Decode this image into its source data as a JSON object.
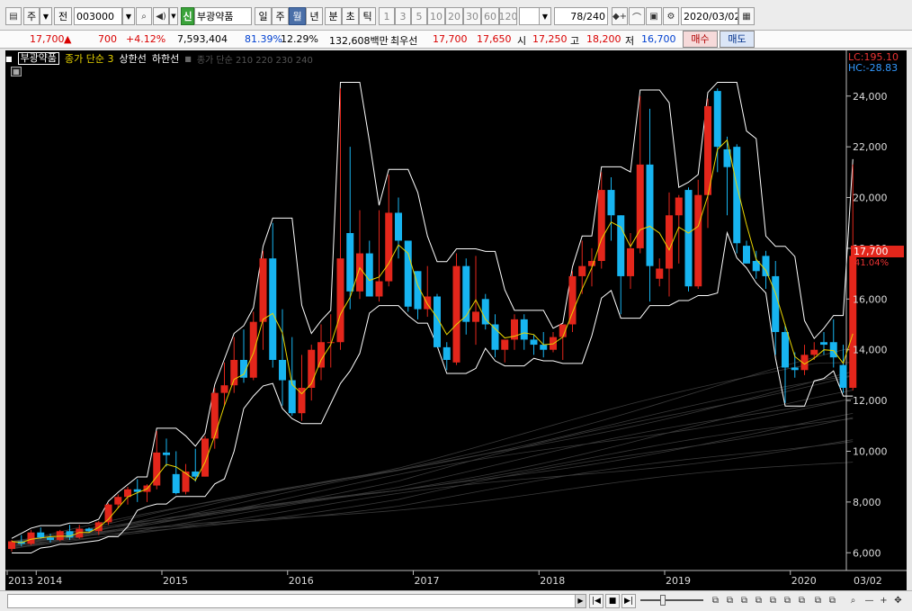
{
  "toolbar": {
    "period_type": "주",
    "prev_label": "전",
    "code": "003000",
    "search_icon": "magnifier-icon",
    "stock_badge": "신",
    "stock_name": "부광약품",
    "period_buttons": [
      "일",
      "주",
      "월",
      "년",
      "분",
      "초",
      "틱"
    ],
    "active_period": "월",
    "interval_buttons": [
      "1",
      "3",
      "5",
      "10",
      "20",
      "30",
      "60",
      "120"
    ],
    "count_value": "78",
    "count_total": "/240",
    "date": "2020/03/02"
  },
  "quote": {
    "price": "17,700",
    "arrow": "▲",
    "change": "700",
    "change_pct": "+4.12%",
    "volume": "7,593,404",
    "vol_ratio": "81.39%",
    "turnover": "12.29%",
    "amount": "132,608백만",
    "best_label": "최우선",
    "ask": "17,700",
    "bid": "17,650",
    "open_label": "시",
    "open": "17,250",
    "high_label": "고",
    "high": "18,200",
    "low_label": "저",
    "low": "16,700",
    "buy_label": "매수",
    "sell_label": "매도"
  },
  "chart_header": {
    "name_box": "부광약품",
    "ma_label": "종가 단순 3",
    "upper_band": "상한선",
    "lower_band": "하한선",
    "long_ma": "종가 단순 210 220 230 240",
    "lc": "LC:195.10",
    "hc": "HC:-28.83",
    "last_price": "17,700",
    "last_pct": "41.04%"
  },
  "colors": {
    "up": "#e3261b",
    "down": "#17b4f0",
    "ma": "#e8d400",
    "band": "#ffffff",
    "bg": "#000000"
  },
  "chart_data": {
    "type": "candlestick",
    "ylim": [
      5300,
      25800
    ],
    "y_ticks": [
      "6,000",
      "8,000",
      "10,000",
      "12,000",
      "14,000",
      "16,000",
      "18,000",
      "20,000",
      "22,000",
      "24,000"
    ],
    "y_tick_values": [
      6000,
      8000,
      10000,
      12000,
      14000,
      16000,
      18000,
      20000,
      22000,
      24000
    ],
    "x_labels": [
      "2013",
      "2014",
      "2015",
      "2016",
      "2017",
      "2018",
      "2019",
      "2020",
      "03/02"
    ],
    "candles": [
      {
        "o": 6150,
        "h": 6500,
        "l": 6050,
        "c": 6450
      },
      {
        "o": 6450,
        "h": 6700,
        "l": 6250,
        "c": 6350
      },
      {
        "o": 6350,
        "h": 6900,
        "l": 6300,
        "c": 6800
      },
      {
        "o": 6800,
        "h": 7000,
        "l": 6550,
        "c": 6600
      },
      {
        "o": 6600,
        "h": 6750,
        "l": 6400,
        "c": 6500
      },
      {
        "o": 6500,
        "h": 6900,
        "l": 6450,
        "c": 6850
      },
      {
        "o": 6850,
        "h": 7100,
        "l": 6500,
        "c": 6600
      },
      {
        "o": 6600,
        "h": 7100,
        "l": 6550,
        "c": 6950
      },
      {
        "o": 6950,
        "h": 7000,
        "l": 6800,
        "c": 6850
      },
      {
        "o": 6850,
        "h": 7250,
        "l": 6700,
        "c": 7200
      },
      {
        "o": 7200,
        "h": 7950,
        "l": 7100,
        "c": 7900
      },
      {
        "o": 7900,
        "h": 8300,
        "l": 7750,
        "c": 8200
      },
      {
        "o": 8200,
        "h": 8600,
        "l": 7900,
        "c": 8500
      },
      {
        "o": 8500,
        "h": 8900,
        "l": 8000,
        "c": 8400
      },
      {
        "o": 8400,
        "h": 8700,
        "l": 8000,
        "c": 8650
      },
      {
        "o": 8650,
        "h": 10800,
        "l": 8500,
        "c": 9950
      },
      {
        "o": 9950,
        "h": 10500,
        "l": 9400,
        "c": 9850
      },
      {
        "o": 9100,
        "h": 10000,
        "l": 8300,
        "c": 8350
      },
      {
        "o": 8400,
        "h": 9500,
        "l": 8300,
        "c": 9200
      },
      {
        "o": 9200,
        "h": 10100,
        "l": 8800,
        "c": 9000
      },
      {
        "o": 9000,
        "h": 10600,
        "l": 9000,
        "c": 10500
      },
      {
        "o": 10500,
        "h": 12500,
        "l": 10100,
        "c": 12300
      },
      {
        "o": 12300,
        "h": 13500,
        "l": 11800,
        "c": 12600
      },
      {
        "o": 12600,
        "h": 14500,
        "l": 12300,
        "c": 13600
      },
      {
        "o": 13600,
        "h": 14800,
        "l": 12700,
        "c": 12900
      },
      {
        "o": 12900,
        "h": 15500,
        "l": 12800,
        "c": 15100
      },
      {
        "o": 15100,
        "h": 17900,
        "l": 14000,
        "c": 17600
      },
      {
        "o": 17600,
        "h": 19000,
        "l": 13300,
        "c": 13600
      },
      {
        "o": 13600,
        "h": 15600,
        "l": 11800,
        "c": 12800
      },
      {
        "o": 12800,
        "h": 14500,
        "l": 11400,
        "c": 11500
      },
      {
        "o": 11500,
        "h": 13800,
        "l": 11200,
        "c": 12500
      },
      {
        "o": 12500,
        "h": 14200,
        "l": 12000,
        "c": 14000
      },
      {
        "o": 13300,
        "h": 15000,
        "l": 12800,
        "c": 14300
      },
      {
        "o": 14300,
        "h": 15400,
        "l": 13300,
        "c": 14300
      },
      {
        "o": 14300,
        "h": 24300,
        "l": 14000,
        "c": 17600
      },
      {
        "o": 18600,
        "h": 22000,
        "l": 15600,
        "c": 16300
      },
      {
        "o": 16300,
        "h": 19500,
        "l": 16000,
        "c": 17800
      },
      {
        "o": 17800,
        "h": 18300,
        "l": 16800,
        "c": 16100
      },
      {
        "o": 16100,
        "h": 19500,
        "l": 15900,
        "c": 16700
      },
      {
        "o": 16700,
        "h": 20900,
        "l": 16500,
        "c": 19400
      },
      {
        "o": 19400,
        "h": 20000,
        "l": 17600,
        "c": 18300
      },
      {
        "o": 18300,
        "h": 18300,
        "l": 15500,
        "c": 15700
      },
      {
        "o": 17100,
        "h": 17100,
        "l": 15200,
        "c": 15600
      },
      {
        "o": 15600,
        "h": 17300,
        "l": 15300,
        "c": 16100
      },
      {
        "o": 16100,
        "h": 16200,
        "l": 14300,
        "c": 14100
      },
      {
        "o": 14100,
        "h": 14300,
        "l": 13200,
        "c": 13600
      },
      {
        "o": 13500,
        "h": 17800,
        "l": 13400,
        "c": 17300
      },
      {
        "o": 17300,
        "h": 17600,
        "l": 14600,
        "c": 15100
      },
      {
        "o": 15100,
        "h": 17700,
        "l": 14200,
        "c": 15500
      },
      {
        "o": 16000,
        "h": 16200,
        "l": 14800,
        "c": 15000
      },
      {
        "o": 15000,
        "h": 15400,
        "l": 13700,
        "c": 14000
      },
      {
        "o": 14000,
        "h": 14200,
        "l": 13500,
        "c": 14400
      },
      {
        "o": 14400,
        "h": 15400,
        "l": 14000,
        "c": 15200
      },
      {
        "o": 15200,
        "h": 15400,
        "l": 14000,
        "c": 14400
      },
      {
        "o": 14400,
        "h": 14600,
        "l": 13800,
        "c": 14200
      },
      {
        "o": 14200,
        "h": 14700,
        "l": 13700,
        "c": 14000
      },
      {
        "o": 14000,
        "h": 14700,
        "l": 13900,
        "c": 14500
      },
      {
        "o": 14500,
        "h": 14900,
        "l": 13600,
        "c": 15000
      },
      {
        "o": 15000,
        "h": 17100,
        "l": 14700,
        "c": 16900
      },
      {
        "o": 16900,
        "h": 18300,
        "l": 16200,
        "c": 17300
      },
      {
        "o": 17300,
        "h": 18000,
        "l": 16500,
        "c": 17500
      },
      {
        "o": 17500,
        "h": 21000,
        "l": 17200,
        "c": 20300
      },
      {
        "o": 20300,
        "h": 20800,
        "l": 18300,
        "c": 19300
      },
      {
        "o": 19300,
        "h": 19300,
        "l": 15400,
        "c": 16900
      },
      {
        "o": 16900,
        "h": 18600,
        "l": 16400,
        "c": 18000
      },
      {
        "o": 18000,
        "h": 24000,
        "l": 17800,
        "c": 21300
      },
      {
        "o": 21300,
        "h": 23500,
        "l": 15900,
        "c": 17300
      },
      {
        "o": 16800,
        "h": 17600,
        "l": 16500,
        "c": 17200
      },
      {
        "o": 17200,
        "h": 20200,
        "l": 16100,
        "c": 19300
      },
      {
        "o": 19300,
        "h": 20100,
        "l": 17400,
        "c": 20000
      },
      {
        "o": 20300,
        "h": 20400,
        "l": 16300,
        "c": 16500
      },
      {
        "o": 16500,
        "h": 20700,
        "l": 16400,
        "c": 20100
      },
      {
        "o": 20100,
        "h": 23900,
        "l": 18800,
        "c": 23600
      },
      {
        "o": 24200,
        "h": 24300,
        "l": 21000,
        "c": 22000
      },
      {
        "o": 21900,
        "h": 22400,
        "l": 19300,
        "c": 21200
      },
      {
        "o": 22000,
        "h": 22100,
        "l": 17800,
        "c": 18200
      },
      {
        "o": 18100,
        "h": 18300,
        "l": 17400,
        "c": 17400
      },
      {
        "o": 17500,
        "h": 17900,
        "l": 16800,
        "c": 17100
      },
      {
        "o": 17700,
        "h": 17900,
        "l": 16400,
        "c": 16900
      },
      {
        "o": 16900,
        "h": 17500,
        "l": 13800,
        "c": 14700
      },
      {
        "o": 14700,
        "h": 15000,
        "l": 11900,
        "c": 13300
      },
      {
        "o": 13300,
        "h": 13900,
        "l": 12900,
        "c": 13200
      },
      {
        "o": 13200,
        "h": 14200,
        "l": 13000,
        "c": 13800
      },
      {
        "o": 13800,
        "h": 14300,
        "l": 13600,
        "c": 14000
      },
      {
        "o": 14300,
        "h": 14700,
        "l": 13800,
        "c": 14200
      },
      {
        "o": 14300,
        "h": 15200,
        "l": 13300,
        "c": 13700
      },
      {
        "o": 13400,
        "h": 14200,
        "l": 12300,
        "c": 12500
      },
      {
        "o": 12500,
        "h": 21300,
        "l": 12400,
        "c": 17700
      }
    ]
  }
}
